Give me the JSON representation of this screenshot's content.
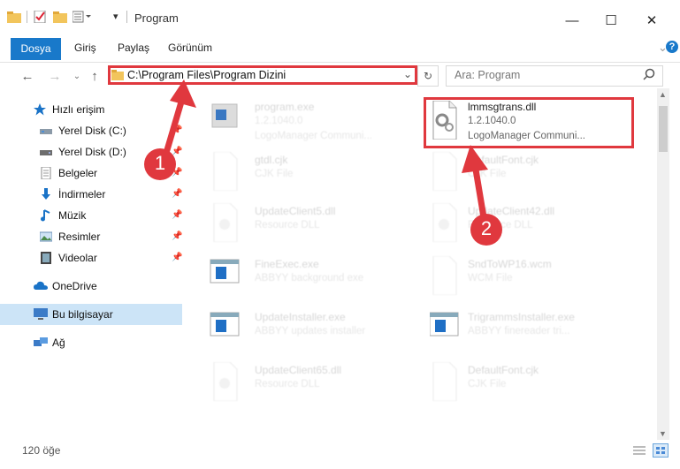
{
  "window": {
    "title": "Program"
  },
  "ribbon": {
    "tabs": [
      "Dosya",
      "Giriş",
      "Paylaş",
      "Görünüm"
    ]
  },
  "address": {
    "path": "C:\\Program Files\\Program Dizini",
    "search_placeholder": "Ara: Program"
  },
  "sidebar": {
    "items": [
      {
        "label": "Hızlı erişim",
        "icon": "star-icon"
      },
      {
        "label": "Yerel Disk (C:)",
        "icon": "drive-icon"
      },
      {
        "label": "Yerel Disk (D:)",
        "icon": "drive-icon"
      },
      {
        "label": "Belgeler",
        "icon": "documents-icon"
      },
      {
        "label": "İndirmeler",
        "icon": "download-icon"
      },
      {
        "label": "Müzik",
        "icon": "music-icon"
      },
      {
        "label": "Resimler",
        "icon": "pictures-icon"
      },
      {
        "label": "Videolar",
        "icon": "video-icon"
      },
      {
        "label": "OneDrive",
        "icon": "cloud-icon"
      },
      {
        "label": "Bu bilgisayar",
        "icon": "computer-icon"
      },
      {
        "label": "Ağ",
        "icon": "network-icon"
      }
    ]
  },
  "files": {
    "highlighted": {
      "name": "lmmsgtrans.dll",
      "version": "1.2.1040.0",
      "company": "LogoManager Communi..."
    },
    "left": [
      {
        "name": "program.exe",
        "l2": "1.2.1040.0",
        "l3": "LogoManager Communi..."
      },
      {
        "name": "gtdl.cjk",
        "l2": "CJK File"
      },
      {
        "name": "UpdateClient5.dll",
        "l2": "Resource DLL"
      },
      {
        "name": "FineExec.exe",
        "l2": "ABBYY background exe"
      },
      {
        "name": "UpdateInstaller.exe",
        "l2": "ABBYY updates installer"
      },
      {
        "name": "UpdateClient65.dll",
        "l2": "Resource DLL"
      }
    ],
    "right": [
      {
        "name": "DefaultFont.cjk",
        "l2": "CJK File"
      },
      {
        "name": "UpdateClient42.dll",
        "l2": "Resource DLL"
      },
      {
        "name": "SndToWP16.wcm",
        "l2": "WCM File"
      },
      {
        "name": "TrigrammsInstaller.exe",
        "l2": "ABBYY finereader tri..."
      },
      {
        "name": "DefaultFont.cjk",
        "l2": "CJK File"
      }
    ]
  },
  "callouts": [
    "1",
    "2"
  ],
  "status": {
    "count": "120 öğe"
  },
  "colors": {
    "accent": "#1979ca",
    "callout": "#e0383e"
  }
}
